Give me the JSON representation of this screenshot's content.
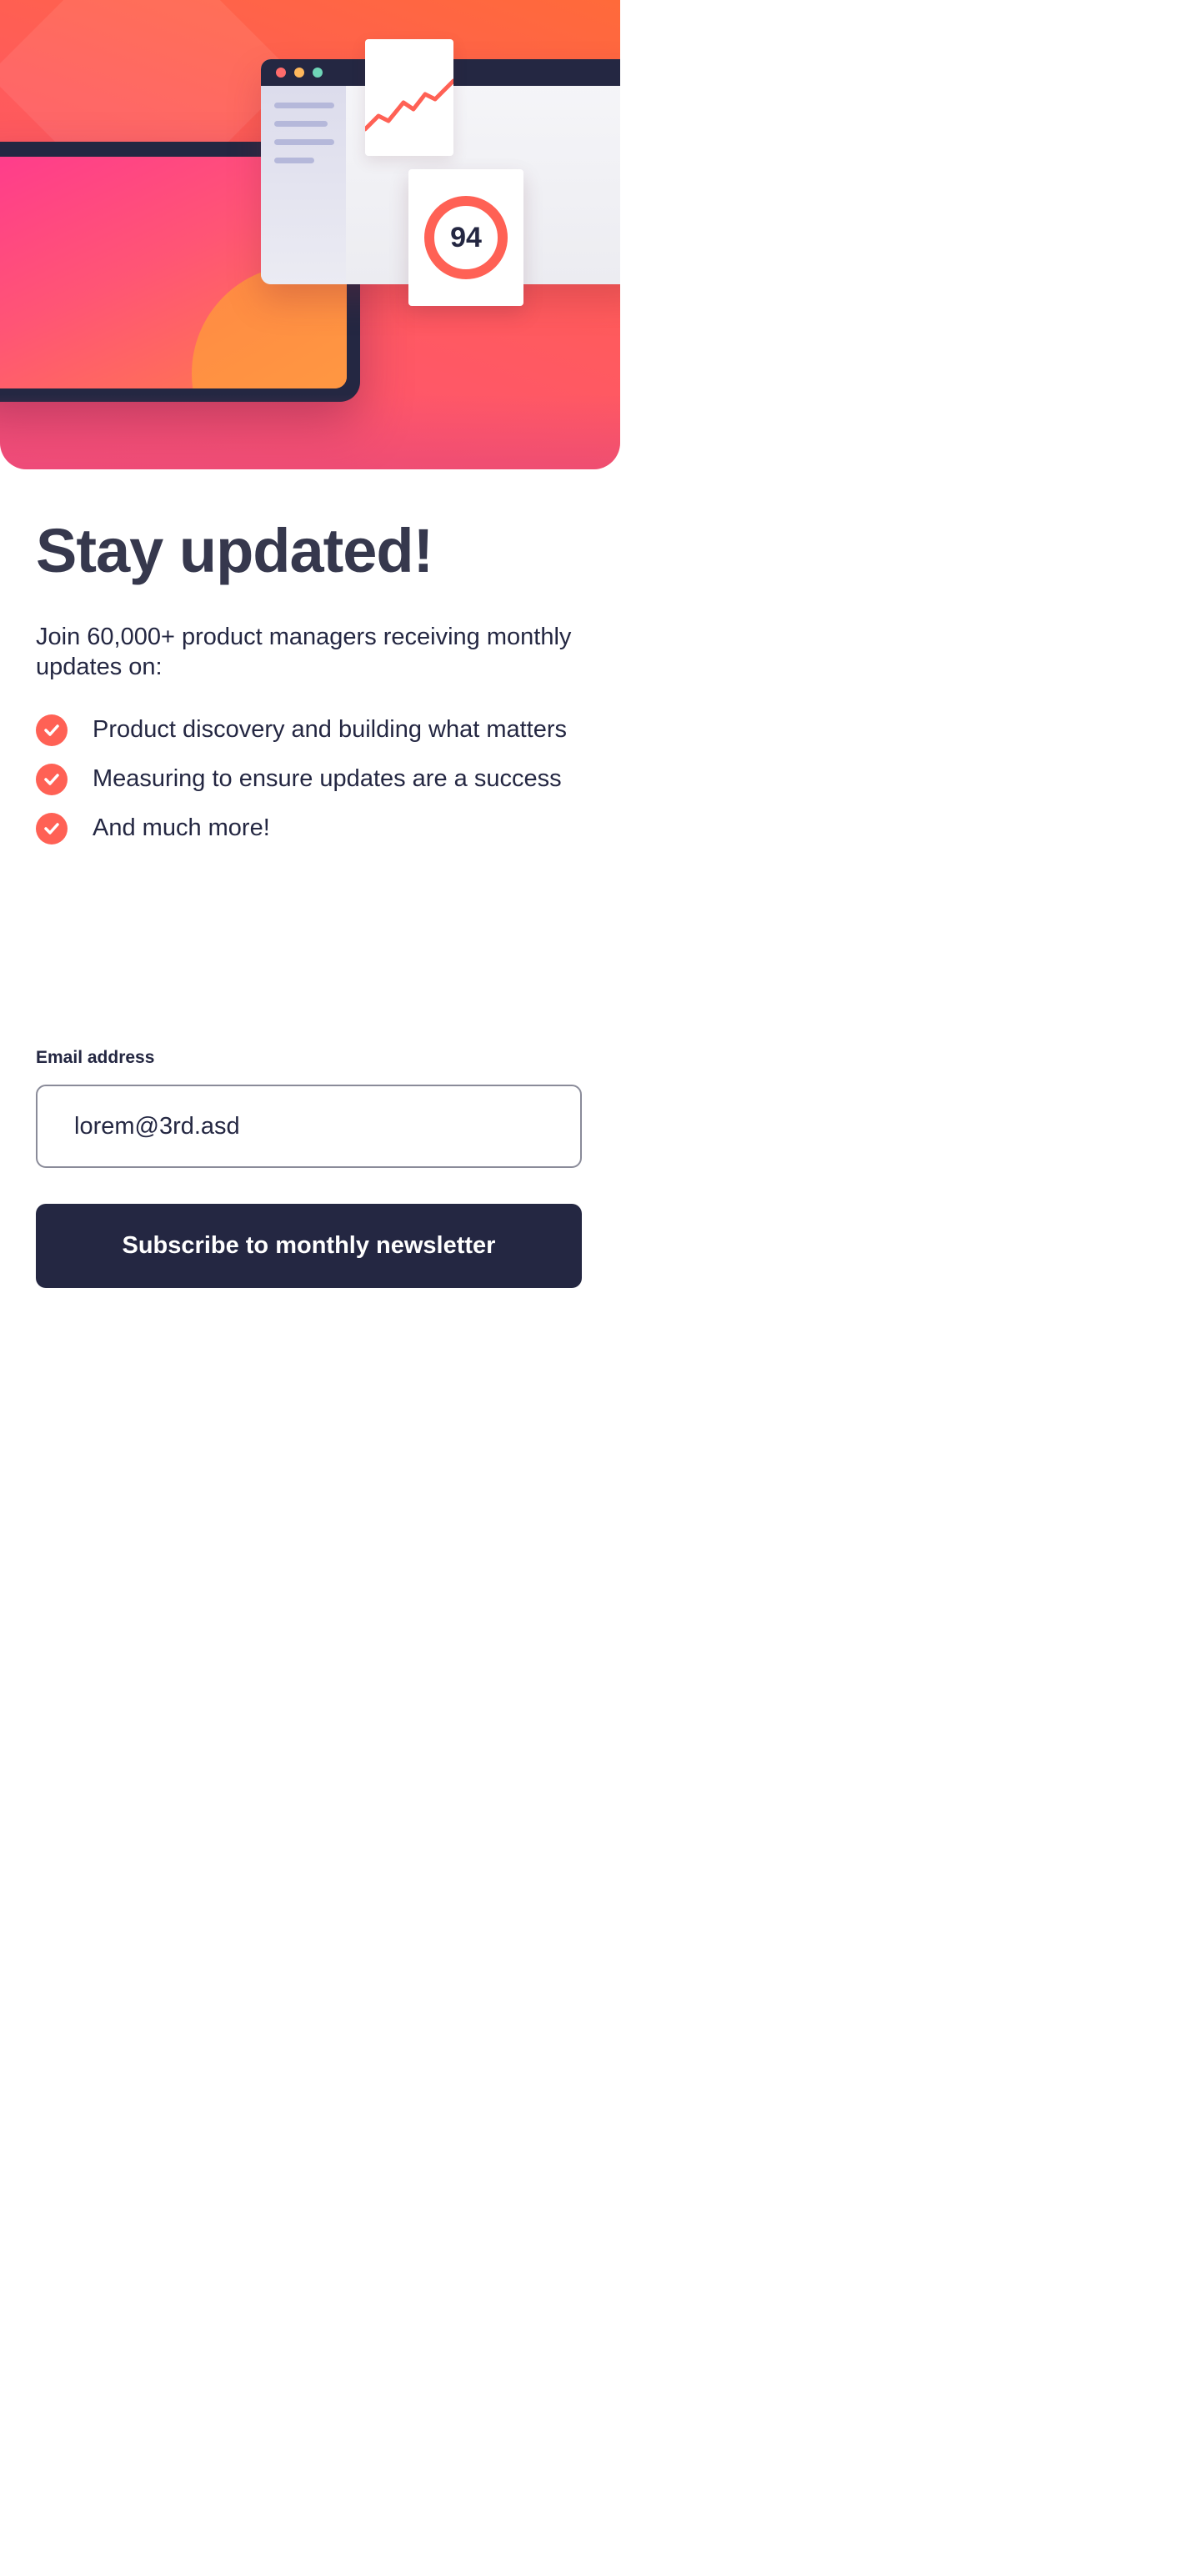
{
  "hero": {
    "score_value": "94",
    "colors": {
      "gradient_start": "#ff6a3a",
      "gradient_end": "#ff527b",
      "window_bar": "#242742",
      "dot_red": "#ff6b6b",
      "dot_yellow": "#ffb85c",
      "dot_green": "#6fd6b8",
      "chart_line": "#ff6155"
    }
  },
  "content": {
    "title": "Stay updated!",
    "intro": "Join 60,000+ product managers receiving monthly updates on:",
    "features": [
      {
        "icon": "check-icon",
        "text": "Product discovery and building what matters"
      },
      {
        "icon": "check-icon",
        "text": "Measuring to ensure updates are a success"
      },
      {
        "icon": "check-icon",
        "text": "And much more!"
      }
    ]
  },
  "form": {
    "email_label": "Email address",
    "email_value": "lorem@3rd.asd",
    "submit_label": "Subscribe to monthly newsletter"
  },
  "theme": {
    "accent": "#ff6155",
    "dark": "#242742",
    "heading": "#36384d",
    "background": "#ffffff"
  }
}
